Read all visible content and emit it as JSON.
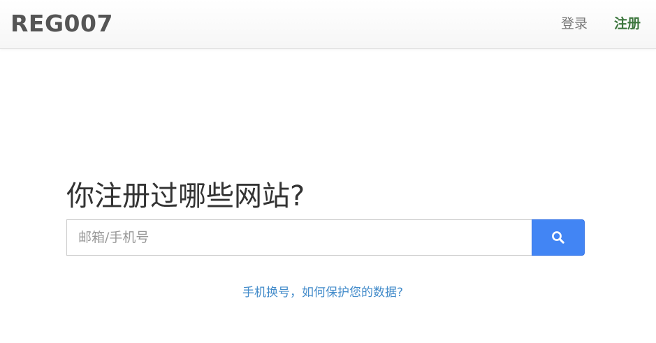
{
  "navbar": {
    "brand": "REG007",
    "login_label": "登录",
    "register_label": "注册"
  },
  "main": {
    "heading": "你注册过哪些网站?",
    "search": {
      "value": "",
      "placeholder": "邮箱/手机号",
      "button_icon": "search-icon"
    },
    "help_link": "手机换号，如何保护您的数据?"
  },
  "colors": {
    "brand_text": "#555555",
    "register_green": "#3c763d",
    "search_button": "#4285f4",
    "link_blue": "#428bca"
  }
}
